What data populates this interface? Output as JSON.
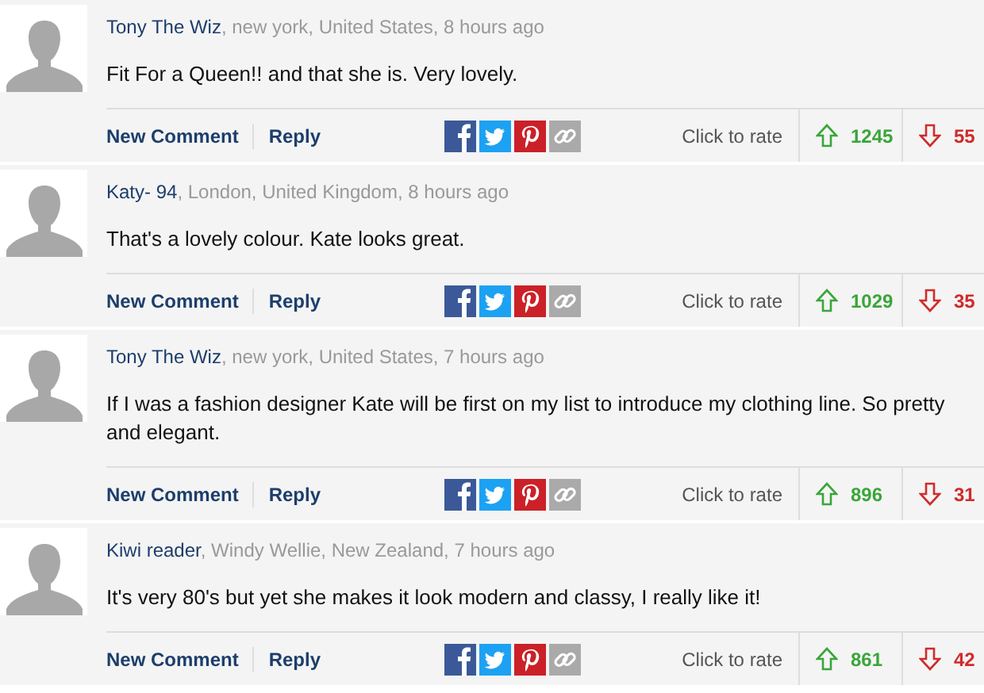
{
  "comments": [
    {
      "author": "Tony The Wiz",
      "meta": ", new york, United States, 8 hours ago",
      "text": "Fit For a Queen!! and that she is. Very lovely.",
      "new_comment": "New Comment",
      "reply": "Reply",
      "rate_label": "Click to rate",
      "up": "1245",
      "down": "55"
    },
    {
      "author": "Katy- 94",
      "meta": ", London, United Kingdom, 8 hours ago",
      "text": "That's a lovely colour. Kate looks great.",
      "new_comment": "New Comment",
      "reply": "Reply",
      "rate_label": "Click to rate",
      "up": "1029",
      "down": "35"
    },
    {
      "author": "Tony The Wiz",
      "meta": ", new york, United States, 7 hours ago",
      "text": "If I was a fashion designer Kate will be first on my list to introduce my clothing line. So pretty and elegant.",
      "new_comment": "New Comment",
      "reply": "Reply",
      "rate_label": "Click to rate",
      "up": "896",
      "down": "31"
    },
    {
      "author": "Kiwi reader",
      "meta": ", Windy Wellie, New Zealand, 7 hours ago",
      "text": "It's very 80's but yet she makes it look modern and classy, I really like it!",
      "new_comment": "New Comment",
      "reply": "Reply",
      "rate_label": "Click to rate",
      "up": "861",
      "down": "42"
    }
  ]
}
